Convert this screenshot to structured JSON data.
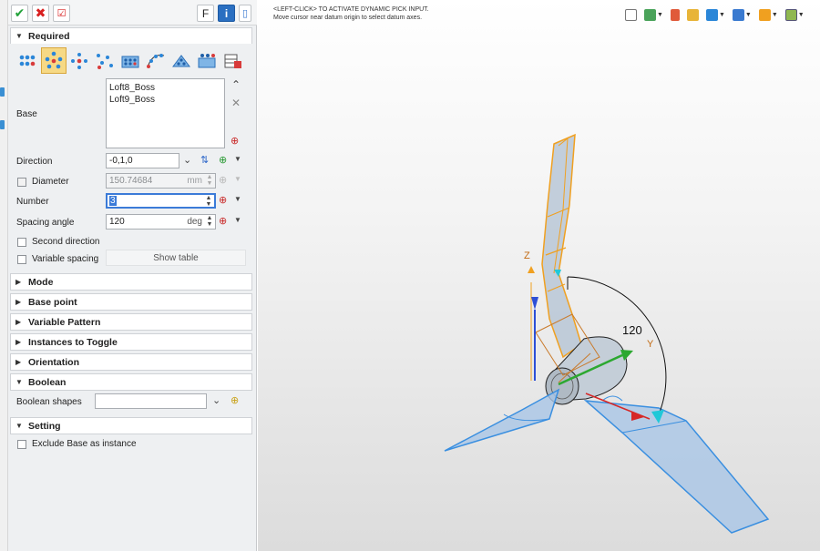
{
  "toolbar": {
    "ok_icon": "check-icon",
    "cancel_icon": "x-icon",
    "apply_icon": "apply-check-icon",
    "f_label": "F",
    "info_label": "i"
  },
  "required": {
    "title": "Required",
    "pattern_types": [
      "linear-pattern-icon",
      "circular-pattern-icon",
      "polygon-pattern-icon",
      "point-pattern-icon",
      "fill-pattern-icon",
      "curve-pattern-icon",
      "layout-pattern-icon",
      "variable-pattern-icon",
      "table-pattern-icon"
    ],
    "active_pattern_index": 1,
    "base_label": "Base",
    "base_items": [
      "Loft8_Boss",
      "Loft9_Boss"
    ],
    "direction_label": "Direction",
    "direction_value": "-0,1,0",
    "diameter_label": "Diameter",
    "diameter_value": "150.74684",
    "diameter_unit": "mm",
    "number_label": "Number",
    "number_value": "3",
    "spacing_label": "Spacing angle",
    "spacing_value": "120",
    "spacing_unit": "deg",
    "second_direction_label": "Second direction",
    "variable_spacing_label": "Variable spacing",
    "show_table_label": "Show table"
  },
  "sections": {
    "mode": "Mode",
    "base_point": "Base point",
    "variable_pattern": "Variable Pattern",
    "instances_to_toggle": "Instances to Toggle",
    "orientation": "Orientation",
    "boolean": "Boolean",
    "setting": "Setting"
  },
  "boolean": {
    "shapes_label": "Boolean shapes",
    "shapes_value": ""
  },
  "setting": {
    "exclude_label": "Exclude Base as instance"
  },
  "viewport": {
    "hint_line1": "<LEFT-CLICK> TO ACTIVATE DYNAMIC PICK INPUT.",
    "hint_line2": "Move cursor near datum origin to select datum axes.",
    "axis_z": "Z",
    "axis_y": "Y",
    "angle_label": "120",
    "colors": {
      "selection": "#3a8fe0",
      "highlight": "#f0a020",
      "axis_z": "#2d4fd6",
      "axis_y": "#2ca830",
      "axis_x": "#d62828"
    }
  }
}
